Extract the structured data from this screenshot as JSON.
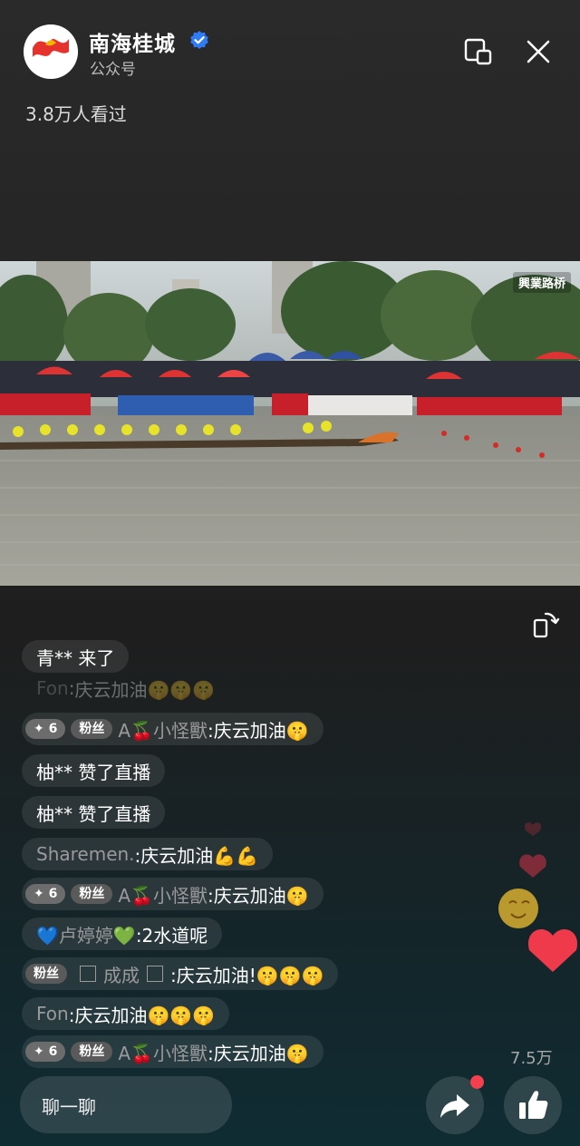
{
  "account": {
    "name": "南海桂城",
    "subtitle": "公众号",
    "avatar_text": "南海桂城"
  },
  "viewers": "3.8万人看过",
  "video": {
    "badge": "興業路桥"
  },
  "chat": [
    {
      "name": "",
      "text": "青** 来了"
    },
    {
      "name": "Fon",
      "text": "庆云加油🤫🤫🤫",
      "faded": true
    },
    {
      "badges": [
        "✦ 6",
        "粉丝"
      ],
      "name": "A🍒小怪獸",
      "text": ":庆云加油🤫"
    },
    {
      "name": "",
      "text": "柚** 赞了直播"
    },
    {
      "name": "",
      "text": "柚** 赞了直播"
    },
    {
      "name": "Sharemen.",
      "text": ":庆云加油💪💪"
    },
    {
      "badges": [
        "✦ 6",
        "粉丝"
      ],
      "name": "A🍒小怪獸",
      "text": ":庆云加油🤫"
    },
    {
      "name": "💙卢婷婷💚",
      "text": ":2水道呢"
    },
    {
      "badges": [
        "粉丝"
      ],
      "name": "成成",
      "text": ":庆云加油!🤫🤫🤫"
    },
    {
      "name": "Fon",
      "text": ":庆云加油🤫🤫🤫"
    },
    {
      "badges": [
        "✦ 6",
        "粉丝"
      ],
      "name": "A🍒小怪獸",
      "text": ":庆云加油🤫"
    }
  ],
  "like_count": "7.5万",
  "input": {
    "placeholder": "聊一聊"
  },
  "colors": {
    "accent_red": "#f43f4f",
    "verified_blue": "#2f7cf6"
  }
}
